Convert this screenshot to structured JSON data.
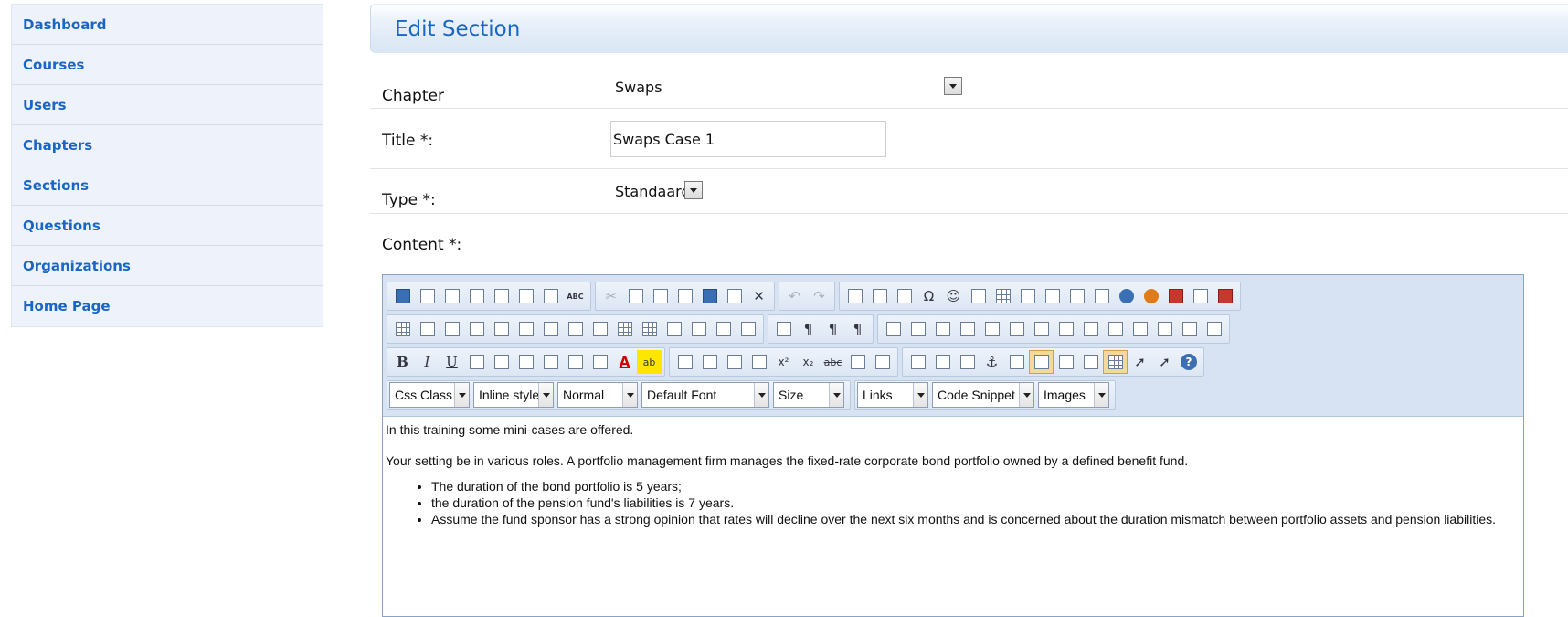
{
  "sidebar": {
    "items": [
      {
        "label": "Dashboard"
      },
      {
        "label": "Courses"
      },
      {
        "label": "Users"
      },
      {
        "label": "Chapters"
      },
      {
        "label": "Sections"
      },
      {
        "label": "Questions"
      },
      {
        "label": "Organizations"
      },
      {
        "label": "Home Page"
      }
    ]
  },
  "header": {
    "title": "Edit Section"
  },
  "form": {
    "chapter_label": "Chapter",
    "chapter_value": "Swaps",
    "title_label": "Title *:",
    "title_value": "Swaps Case 1",
    "type_label": "Type *:",
    "type_value": "Standaard",
    "content_label": "Content *:"
  },
  "editor": {
    "dropdowns": {
      "css_class": "Css Class",
      "inline_style": "Inline style",
      "paragraph": "Normal",
      "font": "Default Font",
      "size": "Size",
      "links": "Links",
      "code_snippet": "Code Snippet",
      "images": "Images"
    },
    "content": {
      "p1": "In this training some mini-cases are offered.",
      "p2": "Your setting be in various roles. A portfolio management firm manages the fixed-rate corporate bond portfolio owned by a defined benefit fund.",
      "bullets": [
        "The duration of the bond portfolio is 5 years;",
        "the duration of the pension fund's liabilities is 7 years.",
        "Assume the fund sponsor has a strong opinion that rates will decline over the next six months and is concerned about the duration mismatch between portfolio assets and pension liabilities."
      ]
    },
    "toolbar_glyphs": {
      "bold": "B",
      "italic": "I",
      "underline": "U",
      "omega": "Ω",
      "smiley": "☺",
      "undo": "↶",
      "redo": "↷",
      "cut": "✂",
      "delete": "✕",
      "superscript": "x²",
      "subscript": "x₂",
      "strike": "abc",
      "help": "?",
      "font_color": "A",
      "highlight": "ab",
      "pilcrow": "¶",
      "anchor": "⚓",
      "abc_check": "ABC",
      "pointer": "➚"
    }
  }
}
